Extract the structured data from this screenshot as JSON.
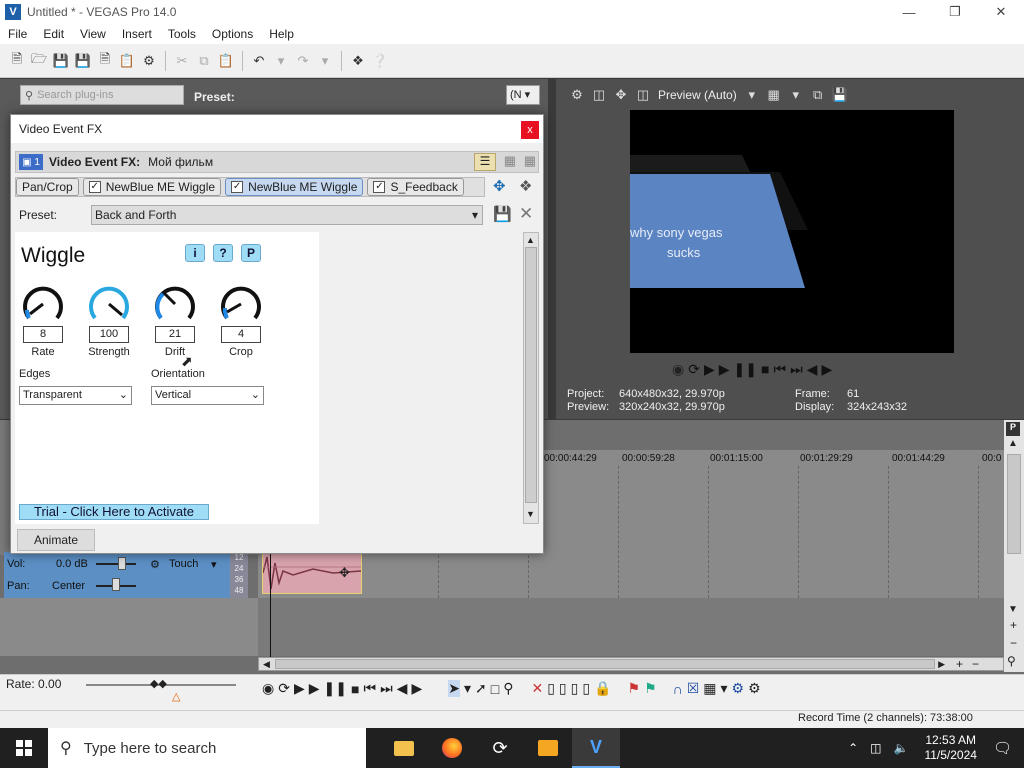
{
  "window": {
    "title": "Untitled * - VEGAS Pro 14.0",
    "app_icon": "vegas-icon"
  },
  "menu": [
    "File",
    "Edit",
    "View",
    "Insert",
    "Tools",
    "Options",
    "Help"
  ],
  "explorer": {
    "search_placeholder": "Search plug-ins",
    "preset_label": "Preset:",
    "view_dropdown": "(N"
  },
  "preview": {
    "quality": "Preview (Auto)",
    "video_text_line1": "why sony vegas",
    "video_text_line2": "sucks",
    "info": {
      "project_k": "Project:",
      "project_v": "640x480x32, 29.970p",
      "frame_k": "Frame:",
      "frame_v": "61",
      "preview_k": "Preview:",
      "preview_v": "320x240x32, 29.970p",
      "display_k": "Display:",
      "display_v": "324x243x32"
    }
  },
  "dialog": {
    "title": "Video Event FX",
    "close": "x",
    "track_num": "1",
    "fx_label": "Video Event FX:",
    "fx_name": "Мой фильм",
    "chain": [
      "Pan/Crop",
      "NewBlue ME Wiggle",
      "NewBlue ME Wiggle",
      "S_Feedback"
    ],
    "preset_label": "Preset:",
    "preset_value": "Back and Forth",
    "plugin": {
      "title": "Wiggle",
      "buttons": [
        "i",
        "?",
        "P"
      ],
      "knobs": [
        {
          "value": "8",
          "label": "Rate"
        },
        {
          "value": "100",
          "label": "Strength"
        },
        {
          "value": "21",
          "label": "Drift"
        },
        {
          "value": "4",
          "label": "Crop"
        }
      ],
      "edges_label": "Edges",
      "edges_value": "Transparent",
      "orientation_label": "Orientation",
      "orientation_value": "Vertical",
      "trial": "Trial - Click Here to Activate"
    },
    "animate": "Animate"
  },
  "timeline": {
    "ruler": [
      "00:00:44:29",
      "00:00:59:28",
      "00:01:15:00",
      "00:01:29:29",
      "00:01:44:29",
      "00:0"
    ],
    "track": {
      "vol_label": "Vol:",
      "vol_value": "0.0 dB",
      "pan_label": "Pan:",
      "pan_value": "Center",
      "mode": "Touch",
      "meter": [
        "12",
        "24",
        "36",
        "48"
      ]
    },
    "rate": "Rate: 0.00",
    "record_time": "Record Time (2 channels): 73:38:00"
  },
  "taskbar": {
    "search": "Type here to search",
    "time": "12:53 AM",
    "date": "11/5/2024"
  }
}
